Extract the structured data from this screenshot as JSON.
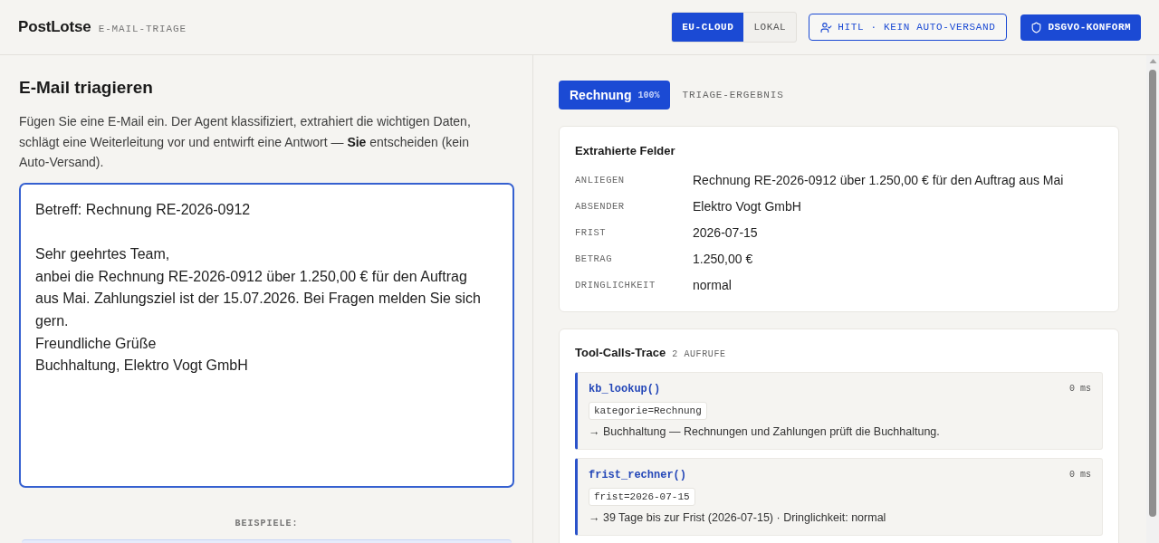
{
  "header": {
    "logo": "PostLotse",
    "subtitle": "E-MAIL-TRIAGE",
    "mode_toggle": [
      {
        "label": "EU-CLOUD",
        "selected": true
      },
      {
        "label": "LOKAL",
        "selected": false
      }
    ],
    "badges": [
      {
        "kind": "outline",
        "label": "HITL · KEIN AUTO-VERSAND"
      },
      {
        "kind": "filled",
        "label": "DSGVO-KONFORM"
      }
    ]
  },
  "input_panel": {
    "title": "E-Mail triagieren",
    "description": "Fügen Sie eine E-Mail ein. Der Agent klassifiziert, extrahiert die wichtigen Daten, schlägt eine Weiterleitung vor und entwirft eine Antwort — **Sie** entscheiden (kein Auto-Versand).",
    "email": {
      "value": "Betreff: Rechnung RE-2026-0912\n\nSehr geehrtes Team,\nanbei die Rechnung RE-2026-0912 über 1.250,00 € für den Auftrag aus Mai. Zahlungsziel ist der 15.07.2026. Bei Fragen melden Sie sich gern.\nFreundliche Grüße\nBuchhaltung, Elektro Vogt GmbH"
    },
    "examples_label": "BEISPIELE:"
  },
  "result_panel": {
    "category": {
      "label": "Rechnung",
      "confidence": "100%"
    },
    "section_label": "TRIAGE-ERGEBNIS",
    "fields_card": {
      "title": "Extrahierte Felder",
      "fields": [
        {
          "label": "ANLIEGEN",
          "value": "Rechnung RE-2026-0912 über 1.250,00 € für den Auftrag aus Mai"
        },
        {
          "label": "ABSENDER",
          "value": "Elektro Vogt GmbH"
        },
        {
          "label": "FRIST",
          "value": "2026-07-15"
        },
        {
          "label": "BETRAG",
          "value": "1.250,00 €"
        },
        {
          "label": "DRINGLICHKEIT",
          "value": "normal"
        }
      ]
    },
    "trace_card": {
      "title": "Tool-Calls-Trace",
      "count": "2 AUFRUFE",
      "calls": [
        {
          "name": "kb_lookup()",
          "duration": "0 ms",
          "args": "kategorie=Rechnung",
          "result": "→ Buchhaltung — Rechnungen und Zahlungen prüft die Buchhaltung."
        },
        {
          "name": "frist_rechner()",
          "duration": "0 ms",
          "args": "frist=2026-07-15",
          "result": "→ 39 Tage bis zur Frist (2026-07-15) · Dringlichkeit: normal"
        }
      ]
    }
  }
}
